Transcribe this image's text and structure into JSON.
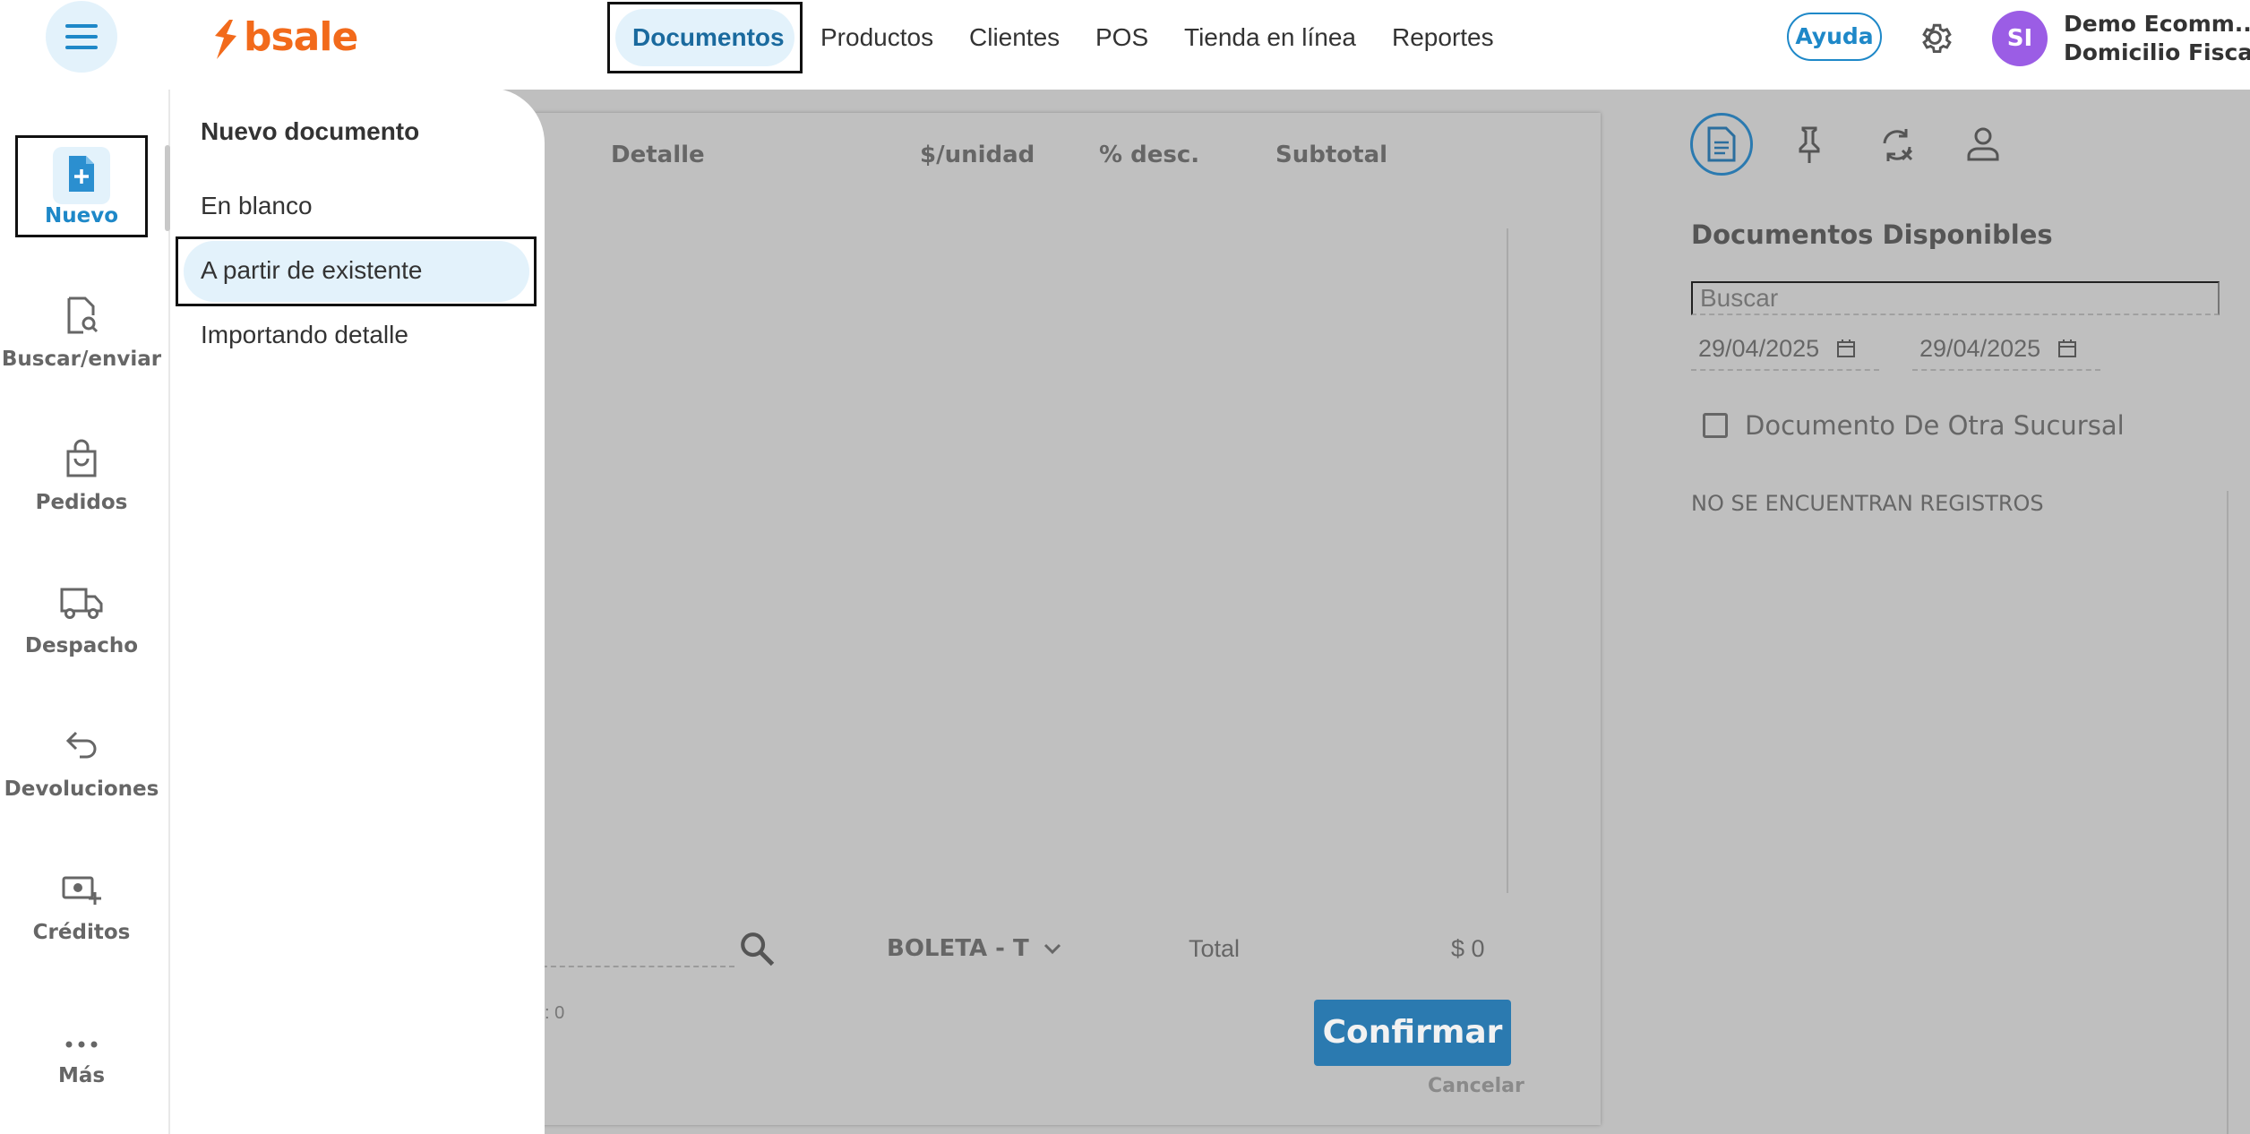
{
  "brand": {
    "name": "bsale",
    "color": "#f26a1b"
  },
  "topnav": {
    "items": [
      {
        "label": "Documentos",
        "active": true
      },
      {
        "label": "Productos"
      },
      {
        "label": "Clientes"
      },
      {
        "label": "POS"
      },
      {
        "label": "Tienda en línea"
      },
      {
        "label": "Reportes"
      }
    ],
    "help_label": "Ayuda",
    "avatar_initials": "SI",
    "account_name": "Demo Ecomm...",
    "account_branch": "Domicilio Fiscal"
  },
  "sidebar": {
    "items": [
      {
        "label": "Nuevo",
        "icon": "file-plus-icon",
        "active": true
      },
      {
        "label": "Buscar/enviar",
        "icon": "file-search-icon"
      },
      {
        "label": "Pedidos",
        "icon": "bag-icon"
      },
      {
        "label": "Despacho",
        "icon": "truck-icon"
      },
      {
        "label": "Devoluciones",
        "icon": "return-arrow-icon"
      },
      {
        "label": "Créditos",
        "icon": "money-plus-icon"
      },
      {
        "label": "Más",
        "icon": "more-dots-icon"
      }
    ]
  },
  "menu": {
    "title": "Nuevo documento",
    "items": [
      {
        "label": "En blanco"
      },
      {
        "label": "A partir de existente",
        "highlighted": true
      },
      {
        "label": "Importando detalle"
      }
    ]
  },
  "document": {
    "columns": [
      "Detalle",
      "$/unidad",
      "% desc.",
      "Subtotal"
    ],
    "doc_type": "BOLETA - T",
    "total_label": "Total",
    "total_value": "$ 0",
    "count_text": ": 0",
    "confirm_label": "Confirmar",
    "cancel_label": "Cancelar"
  },
  "right_panel": {
    "title": "Documentos Disponibles",
    "search_placeholder": "Buscar",
    "date_from": "29/04/2025",
    "date_to": "29/04/2025",
    "checkbox_label": "Documento De Otra Sucursal",
    "checkbox_checked": false,
    "empty_text": "NO SE ENCUENTRAN REGISTROS"
  },
  "colors": {
    "accent": "#1e88c8",
    "accent_light": "#e3f2fb",
    "confirm_button": "#2b7ab0",
    "avatar": "#9b5de5"
  }
}
